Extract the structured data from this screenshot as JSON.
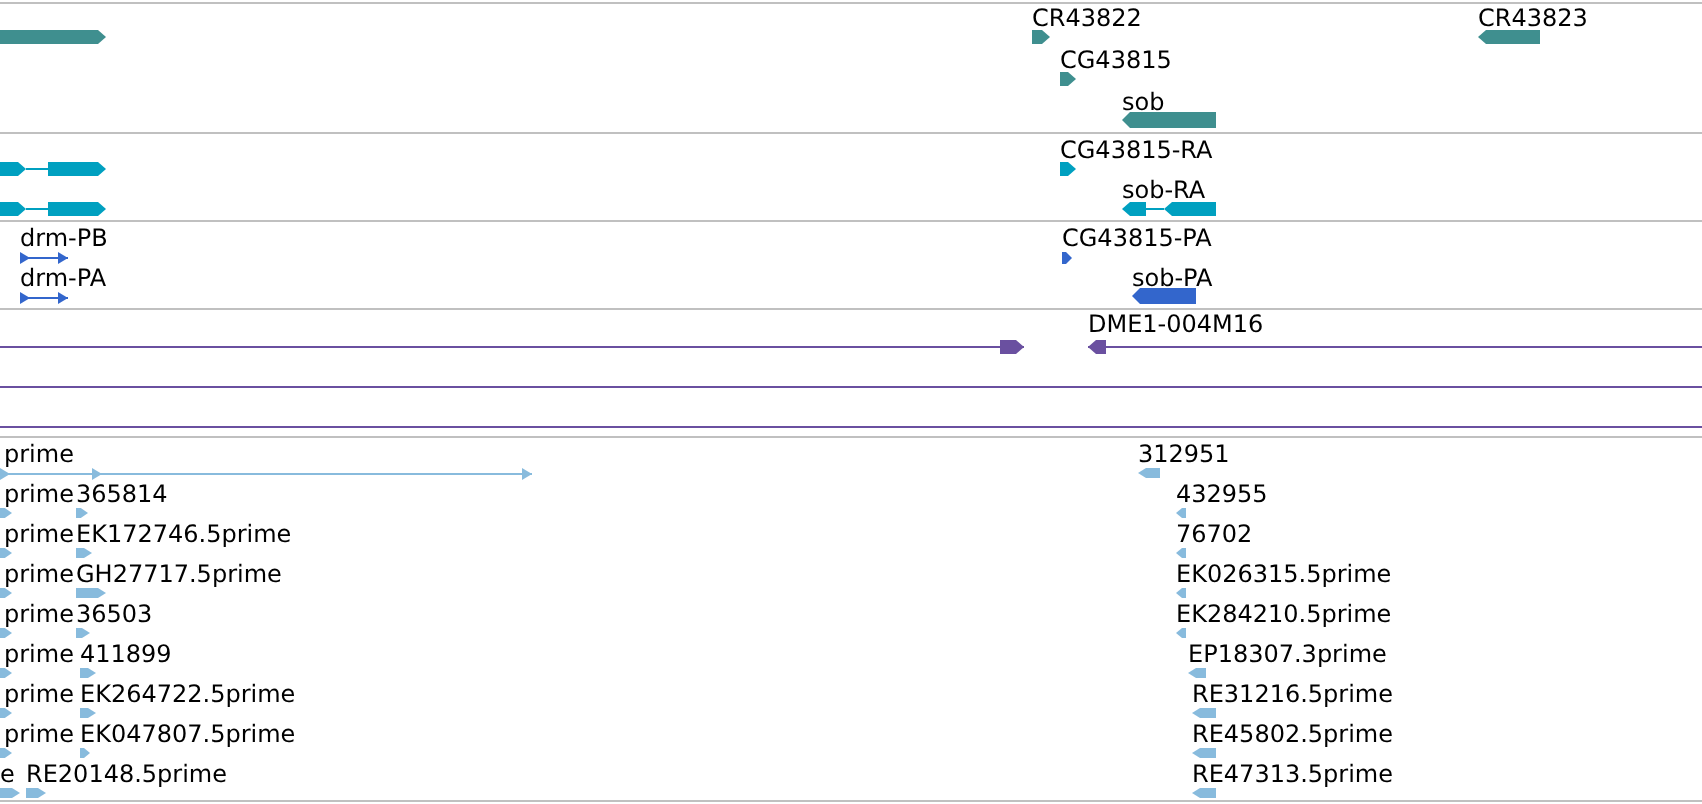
{
  "tracks": [
    {
      "kind": "gene",
      "features": [
        {
          "forward": true
        },
        {
          "label": "CR43822",
          "forward": true
        },
        {
          "label": "CG43815",
          "forward": true
        },
        {
          "label": "sob",
          "forward": false
        },
        {
          "label": "CR43823",
          "forward": false
        }
      ]
    },
    {
      "kind": "transcript",
      "features": [
        {
          "forward": true
        },
        {
          "forward": true
        },
        {
          "label": "CG43815-RA",
          "forward": true
        },
        {
          "label": "sob-RA",
          "forward": false
        }
      ]
    },
    {
      "kind": "protein",
      "features": [
        {
          "label": "drm-PB",
          "forward": true
        },
        {
          "label": "drm-PA",
          "forward": true
        },
        {
          "label": "CG43815-PA",
          "forward": true
        },
        {
          "label": "sob-PA",
          "forward": false
        }
      ]
    },
    {
      "kind": "clone",
      "features": [
        {
          "forward": true
        },
        {
          "label": "DME1-004M16",
          "forward": false
        }
      ]
    },
    {
      "kind": "est",
      "features": [
        {
          "label": "prime",
          "forward": true
        },
        {
          "label": "312951",
          "forward": false
        },
        {
          "label": "prime",
          "forward": true
        },
        {
          "label": "365814",
          "forward": true
        },
        {
          "label": "432955",
          "forward": false
        },
        {
          "label": "prime",
          "forward": true
        },
        {
          "label": "EK172746.5prime",
          "forward": true
        },
        {
          "label": "76702",
          "forward": false
        },
        {
          "label": "prime",
          "forward": true
        },
        {
          "label": "GH27717.5prime",
          "forward": true
        },
        {
          "label": "EK026315.5prime",
          "forward": false
        },
        {
          "label": "prime",
          "forward": true
        },
        {
          "label": "36503",
          "forward": true
        },
        {
          "label": "EK284210.5prime",
          "forward": false
        },
        {
          "label": "prime",
          "forward": true
        },
        {
          "label": "411899",
          "forward": true
        },
        {
          "label": "EP18307.3prime",
          "forward": false
        },
        {
          "label": "prime",
          "forward": true
        },
        {
          "label": "EK264722.5prime",
          "forward": true
        },
        {
          "label": "RE31216.5prime",
          "forward": false
        },
        {
          "label": "prime",
          "forward": true
        },
        {
          "label": "EK047807.5prime",
          "forward": true
        },
        {
          "label": "RE45802.5prime",
          "forward": false
        },
        {
          "label": "e",
          "forward": true
        },
        {
          "label": "RE20148.5prime",
          "forward": true
        },
        {
          "label": "RE47313.5prime",
          "forward": false
        }
      ]
    }
  ]
}
